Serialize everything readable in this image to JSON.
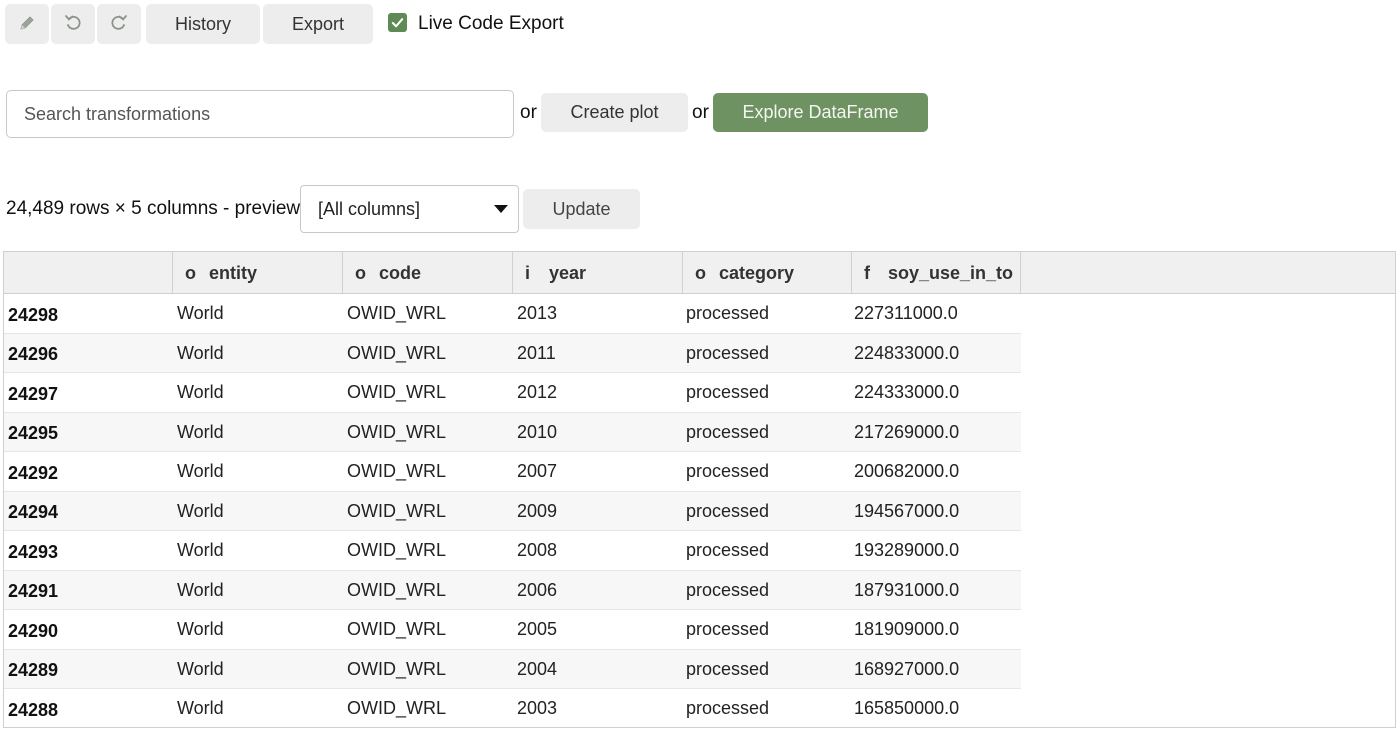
{
  "toolbar": {
    "icons": [
      "pencil-icon",
      "undo-icon",
      "redo-icon"
    ],
    "history_label": "History",
    "export_label": "Export",
    "live_code_export_label": "Live Code Export",
    "live_code_export_checked": true
  },
  "search": {
    "placeholder": "Search transformations",
    "or_1": "or",
    "create_plot_label": "Create plot",
    "or_2": "or",
    "explore_label": "Explore DataFrame"
  },
  "preview": {
    "summary": "24,489 rows × 5 columns - preview",
    "column_select_value": "[All columns]",
    "update_label": "Update"
  },
  "colors": {
    "accent_green": "#6f9263",
    "checkbox_green": "#5e8a55",
    "button_gray": "#ededed"
  },
  "table": {
    "columns": [
      {
        "dtype": "o",
        "name": "entity"
      },
      {
        "dtype": "o",
        "name": "code"
      },
      {
        "dtype": "i",
        "name": "year"
      },
      {
        "dtype": "o",
        "name": "category"
      },
      {
        "dtype": "f",
        "name": "soy_use_in_to"
      }
    ],
    "rows": [
      {
        "index": "24298",
        "cells": [
          "World",
          "OWID_WRL",
          "2013",
          "processed",
          "227311000.0"
        ]
      },
      {
        "index": "24296",
        "cells": [
          "World",
          "OWID_WRL",
          "2011",
          "processed",
          "224833000.0"
        ]
      },
      {
        "index": "24297",
        "cells": [
          "World",
          "OWID_WRL",
          "2012",
          "processed",
          "224333000.0"
        ]
      },
      {
        "index": "24295",
        "cells": [
          "World",
          "OWID_WRL",
          "2010",
          "processed",
          "217269000.0"
        ]
      },
      {
        "index": "24292",
        "cells": [
          "World",
          "OWID_WRL",
          "2007",
          "processed",
          "200682000.0"
        ]
      },
      {
        "index": "24294",
        "cells": [
          "World",
          "OWID_WRL",
          "2009",
          "processed",
          "194567000.0"
        ]
      },
      {
        "index": "24293",
        "cells": [
          "World",
          "OWID_WRL",
          "2008",
          "processed",
          "193289000.0"
        ]
      },
      {
        "index": "24291",
        "cells": [
          "World",
          "OWID_WRL",
          "2006",
          "processed",
          "187931000.0"
        ]
      },
      {
        "index": "24290",
        "cells": [
          "World",
          "OWID_WRL",
          "2005",
          "processed",
          "181909000.0"
        ]
      },
      {
        "index": "24289",
        "cells": [
          "World",
          "OWID_WRL",
          "2004",
          "processed",
          "168927000.0"
        ]
      },
      {
        "index": "24288",
        "cells": [
          "World",
          "OWID_WRL",
          "2003",
          "processed",
          "165850000.0"
        ]
      }
    ]
  }
}
